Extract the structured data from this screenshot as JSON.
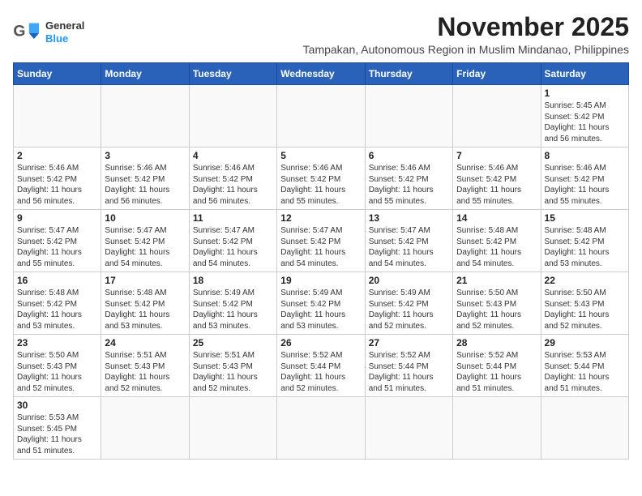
{
  "header": {
    "logo_line1": "General",
    "logo_line2": "Blue",
    "month_title": "November 2025",
    "subtitle": "Tampakan, Autonomous Region in Muslim Mindanao, Philippines"
  },
  "days_of_week": [
    "Sunday",
    "Monday",
    "Tuesday",
    "Wednesday",
    "Thursday",
    "Friday",
    "Saturday"
  ],
  "weeks": [
    [
      {
        "day": "",
        "info": ""
      },
      {
        "day": "",
        "info": ""
      },
      {
        "day": "",
        "info": ""
      },
      {
        "day": "",
        "info": ""
      },
      {
        "day": "",
        "info": ""
      },
      {
        "day": "",
        "info": ""
      },
      {
        "day": "1",
        "info": "Sunrise: 5:45 AM\nSunset: 5:42 PM\nDaylight: 11 hours\nand 56 minutes."
      }
    ],
    [
      {
        "day": "2",
        "info": "Sunrise: 5:46 AM\nSunset: 5:42 PM\nDaylight: 11 hours\nand 56 minutes."
      },
      {
        "day": "3",
        "info": "Sunrise: 5:46 AM\nSunset: 5:42 PM\nDaylight: 11 hours\nand 56 minutes."
      },
      {
        "day": "4",
        "info": "Sunrise: 5:46 AM\nSunset: 5:42 PM\nDaylight: 11 hours\nand 56 minutes."
      },
      {
        "day": "5",
        "info": "Sunrise: 5:46 AM\nSunset: 5:42 PM\nDaylight: 11 hours\nand 55 minutes."
      },
      {
        "day": "6",
        "info": "Sunrise: 5:46 AM\nSunset: 5:42 PM\nDaylight: 11 hours\nand 55 minutes."
      },
      {
        "day": "7",
        "info": "Sunrise: 5:46 AM\nSunset: 5:42 PM\nDaylight: 11 hours\nand 55 minutes."
      },
      {
        "day": "8",
        "info": "Sunrise: 5:46 AM\nSunset: 5:42 PM\nDaylight: 11 hours\nand 55 minutes."
      }
    ],
    [
      {
        "day": "9",
        "info": "Sunrise: 5:47 AM\nSunset: 5:42 PM\nDaylight: 11 hours\nand 55 minutes."
      },
      {
        "day": "10",
        "info": "Sunrise: 5:47 AM\nSunset: 5:42 PM\nDaylight: 11 hours\nand 54 minutes."
      },
      {
        "day": "11",
        "info": "Sunrise: 5:47 AM\nSunset: 5:42 PM\nDaylight: 11 hours\nand 54 minutes."
      },
      {
        "day": "12",
        "info": "Sunrise: 5:47 AM\nSunset: 5:42 PM\nDaylight: 11 hours\nand 54 minutes."
      },
      {
        "day": "13",
        "info": "Sunrise: 5:47 AM\nSunset: 5:42 PM\nDaylight: 11 hours\nand 54 minutes."
      },
      {
        "day": "14",
        "info": "Sunrise: 5:48 AM\nSunset: 5:42 PM\nDaylight: 11 hours\nand 54 minutes."
      },
      {
        "day": "15",
        "info": "Sunrise: 5:48 AM\nSunset: 5:42 PM\nDaylight: 11 hours\nand 53 minutes."
      }
    ],
    [
      {
        "day": "16",
        "info": "Sunrise: 5:48 AM\nSunset: 5:42 PM\nDaylight: 11 hours\nand 53 minutes."
      },
      {
        "day": "17",
        "info": "Sunrise: 5:48 AM\nSunset: 5:42 PM\nDaylight: 11 hours\nand 53 minutes."
      },
      {
        "day": "18",
        "info": "Sunrise: 5:49 AM\nSunset: 5:42 PM\nDaylight: 11 hours\nand 53 minutes."
      },
      {
        "day": "19",
        "info": "Sunrise: 5:49 AM\nSunset: 5:42 PM\nDaylight: 11 hours\nand 53 minutes."
      },
      {
        "day": "20",
        "info": "Sunrise: 5:49 AM\nSunset: 5:42 PM\nDaylight: 11 hours\nand 52 minutes."
      },
      {
        "day": "21",
        "info": "Sunrise: 5:50 AM\nSunset: 5:43 PM\nDaylight: 11 hours\nand 52 minutes."
      },
      {
        "day": "22",
        "info": "Sunrise: 5:50 AM\nSunset: 5:43 PM\nDaylight: 11 hours\nand 52 minutes."
      }
    ],
    [
      {
        "day": "23",
        "info": "Sunrise: 5:50 AM\nSunset: 5:43 PM\nDaylight: 11 hours\nand 52 minutes."
      },
      {
        "day": "24",
        "info": "Sunrise: 5:51 AM\nSunset: 5:43 PM\nDaylight: 11 hours\nand 52 minutes."
      },
      {
        "day": "25",
        "info": "Sunrise: 5:51 AM\nSunset: 5:43 PM\nDaylight: 11 hours\nand 52 minutes."
      },
      {
        "day": "26",
        "info": "Sunrise: 5:52 AM\nSunset: 5:44 PM\nDaylight: 11 hours\nand 52 minutes."
      },
      {
        "day": "27",
        "info": "Sunrise: 5:52 AM\nSunset: 5:44 PM\nDaylight: 11 hours\nand 51 minutes."
      },
      {
        "day": "28",
        "info": "Sunrise: 5:52 AM\nSunset: 5:44 PM\nDaylight: 11 hours\nand 51 minutes."
      },
      {
        "day": "29",
        "info": "Sunrise: 5:53 AM\nSunset: 5:44 PM\nDaylight: 11 hours\nand 51 minutes."
      }
    ],
    [
      {
        "day": "30",
        "info": "Sunrise: 5:53 AM\nSunset: 5:45 PM\nDaylight: 11 hours\nand 51 minutes."
      },
      {
        "day": "",
        "info": ""
      },
      {
        "day": "",
        "info": ""
      },
      {
        "day": "",
        "info": ""
      },
      {
        "day": "",
        "info": ""
      },
      {
        "day": "",
        "info": ""
      },
      {
        "day": "",
        "info": ""
      }
    ]
  ]
}
